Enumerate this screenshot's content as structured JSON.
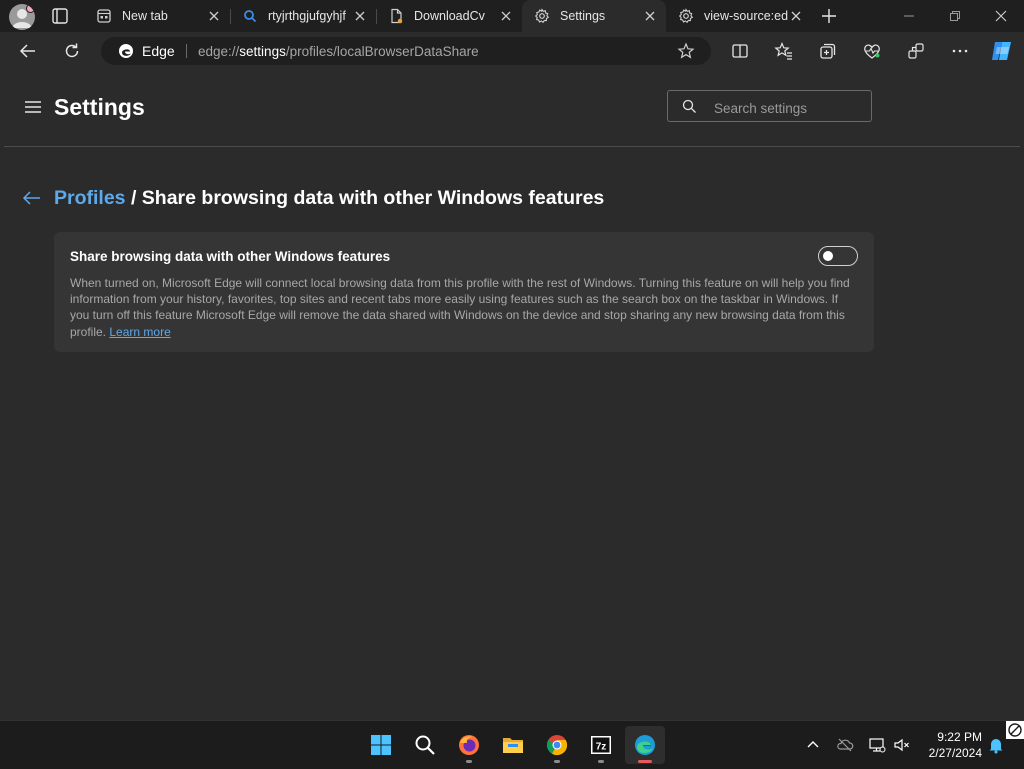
{
  "browser": {
    "tabs": [
      {
        "label": "New tab",
        "icon": "newtab-page-icon",
        "active": false
      },
      {
        "label": "rtyjrthgjufgyhjf",
        "icon": "search-icon",
        "active": false
      },
      {
        "label": "DownloadCv",
        "icon": "document-icon",
        "active": false
      },
      {
        "label": "Settings",
        "icon": "gear-icon",
        "active": true
      },
      {
        "label": "view-source:ed",
        "icon": "gear-icon",
        "active": false
      }
    ],
    "address": {
      "site_label": "Edge",
      "url_prefix": "edge://",
      "url_host": "settings",
      "url_path": "/profiles/localBrowserDataShare"
    }
  },
  "settings": {
    "title": "Settings",
    "search_placeholder": "Search settings"
  },
  "page": {
    "breadcrumb_link": "Profiles",
    "breadcrumb_sep": " / ",
    "heading": "Share browsing data with other Windows features",
    "card": {
      "title": "Share browsing data with other Windows features",
      "description": "When turned on, Microsoft Edge will connect local browsing data from this profile with the rest of Windows. Turning this feature on will help you find information from your history, favorites, top sites and recent tabs more easily using features such as the search box on the taskbar in Windows. If you turn off this feature Microsoft Edge will remove the data shared with Windows on the device and stop sharing any new browsing data from this profile.",
      "learn_more": "Learn more",
      "toggle_on": false
    }
  },
  "taskbar": {
    "apps": [
      "windows-start-icon",
      "search-icon",
      "firefox-icon",
      "file-explorer-icon",
      "chrome-icon",
      "7zip-icon",
      "edge-icon"
    ],
    "time": "9:22 PM",
    "date": "2/27/2024"
  },
  "colors": {
    "accent": "#5ea8ec",
    "background": "#2b2b2b",
    "card": "#353535",
    "tabstrip": "#1f1f1f"
  }
}
